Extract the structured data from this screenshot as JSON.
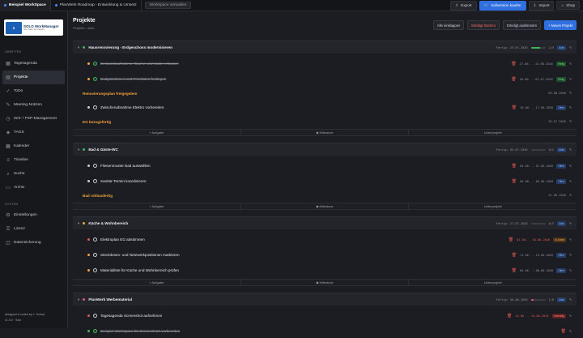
{
  "tabs": [
    {
      "label": "Beispiel WorkSpace",
      "dot": "#4f8cff"
    },
    {
      "label": "PlanWerk Roadmap - Entwicklung & Umsetz",
      "dot": "#4f8cff"
    },
    {
      "label": "Workspace verwalten",
      "dot": ""
    }
  ],
  "topbar": {
    "export": "Export",
    "full": "Vollversion kaufen",
    "import": "Import",
    "shop": "Shop"
  },
  "logo": {
    "name": "SOLO WorkManager",
    "sub": "plan, track, live happier"
  },
  "sidebar": {
    "section1": "ARBEITEN",
    "items": [
      {
        "label": "Tagesagenda",
        "icon": "calendar-icon"
      },
      {
        "label": "Projekte",
        "icon": "folder-icon"
      },
      {
        "label": "ToDo",
        "icon": "check-icon"
      },
      {
        "label": "Meeting-Notizen",
        "icon": "chat-icon"
      },
      {
        "label": "Zeit- / PSP-Management",
        "icon": "clock-icon"
      },
      {
        "label": "TAGS",
        "icon": "tag-icon"
      },
      {
        "label": "Kalender",
        "icon": "calendar-icon"
      },
      {
        "label": "Timeline",
        "icon": "timeline-icon"
      },
      {
        "label": "Suche",
        "icon": "search-icon"
      },
      {
        "label": "Archiv",
        "icon": "archive-icon"
      }
    ],
    "section2": "SYSTEM",
    "system": [
      {
        "label": "Einstellungen",
        "icon": "gear-icon"
      },
      {
        "label": "Lizenz",
        "icon": "key-icon"
      },
      {
        "label": "Datensicherung",
        "icon": "database-icon"
      }
    ],
    "footer1": "designed & coded by L. Scholz",
    "footer2": "v1.0.0 · Solo"
  },
  "header": {
    "title": "Projekte",
    "breadcrumb": "Projekte  ›  aktiv",
    "expand": "Alle einklappen",
    "delete_done": "Erledigt löschen",
    "hide_done": "Erledigt ausblenden",
    "new_project": "+ Neues Projekt"
  },
  "add_row": {
    "task": "+ Aufgabe",
    "milestone": "◆ Milestone",
    "sub": "Unterprojekt"
  },
  "rows": [
    {
      "kind": "group",
      "title": "Hausrenovierung - Erdgeschoss modernisieren",
      "meta": "Fertig: 25.07.2026",
      "count": "2/3",
      "badge": "Aktiv",
      "badgeClass": "b-offen",
      "progress": 0.66,
      "pcolor": "#3fb65c",
      "bullet": "#3fb65c"
    },
    {
      "kind": "task",
      "title": "Bestandsaufnahme Räume und Maße erfassen",
      "done": true,
      "date": "17.06. - 24.06.2026",
      "badge": "Fertig",
      "badgeClass": "b-fertig",
      "bullet": "#f0a23a"
    },
    {
      "kind": "task",
      "title": "Budgetrahmen und Prioritäten festlegen",
      "done": true,
      "date": "26.06. - 01.07.2026",
      "badge": "Fertig",
      "badgeClass": "b-fertig",
      "bullet": "#f0a23a"
    },
    {
      "kind": "milestone",
      "title": "Renovierungsplan freigegeben",
      "date": "03.08.2026"
    },
    {
      "kind": "task",
      "title": "Zwischenabnahme Elektro vorbereiten",
      "done": false,
      "date": "10.08. - 17.08.2026",
      "badge": "Offen",
      "badgeClass": "b-offen",
      "bullet": "#c9ccd2"
    },
    {
      "kind": "milestone",
      "title": "EG bezugsfertig",
      "date": "25.07.2026"
    },
    {
      "kind": "add"
    },
    {
      "kind": "group",
      "title": "Bad & Gäste-WC",
      "meta": "Fertig: 05.07.2026",
      "count": "0/2",
      "badge": "Aktiv",
      "badgeClass": "b-offen",
      "progress": 0,
      "pcolor": "#3fb65c",
      "bullet": "#3fb65c"
    },
    {
      "kind": "task",
      "title": "Fliesenmuster Bad auswählen",
      "done": false,
      "date": "03.06. - 07.06.2026",
      "badge": "Offen",
      "badgeClass": "b-offen",
      "bullet": "#c9ccd2"
    },
    {
      "kind": "task",
      "title": "Sanitär-Termin koordinieren",
      "done": false,
      "date": "05.06. - 09.06.2026",
      "badge": "Offen",
      "badgeClass": "b-offen",
      "bullet": "#c9ccd2"
    },
    {
      "kind": "milestone",
      "title": "Bad rohbaufertig",
      "date": "21.06.2026"
    },
    {
      "kind": "add"
    },
    {
      "kind": "group",
      "title": "Küche & Wohnbereich",
      "meta": "Fertig: 21.07.2026",
      "count": "0/3",
      "badge": "Aktiv",
      "badgeClass": "b-offen",
      "progress": 0,
      "pcolor": "#3fb65c",
      "bullet": "#f0a23a"
    },
    {
      "kind": "task",
      "title": "Elektroplan EG abstimmen",
      "done": false,
      "date": "01.06. - 04.06.2026",
      "badge": "In Arbeit",
      "badgeClass": "b-arbeit",
      "bullet": "#e0584f",
      "late": true
    },
    {
      "kind": "task",
      "title": "Steckdosen- und Netzwerkpositionen markieren",
      "done": false,
      "date": "11.06. - 15.06.2026",
      "badge": "Offen",
      "badgeClass": "b-offen",
      "bullet": "#f0a23a"
    },
    {
      "kind": "task",
      "title": "Materialliste für Küche und Wohnbereich prüfen",
      "done": false,
      "date": "05.06. - 08.06.2026",
      "badge": "Offen",
      "badgeClass": "b-offen",
      "bullet": "#f0a23a"
    },
    {
      "kind": "add"
    },
    {
      "kind": "group",
      "title": "PlanWerk Werbematerial",
      "meta": "Fertig: 30.06.2026",
      "count": "1/6",
      "badge": "Aktiv",
      "badgeClass": "b-offen",
      "progress": 0.2,
      "pcolor": "#e0509a",
      "bullet": "#e0509a"
    },
    {
      "kind": "task",
      "title": "Tagesagenda Screenshot aufnehmen",
      "done": false,
      "date": "15.06. - 15.06.2026",
      "badge": "Überfällig",
      "badgeClass": "b-uber",
      "bullet": "#e0584f",
      "late": true
    },
    {
      "kind": "task",
      "title": "Beispiel-Workspace für Screenshots vorbereiten",
      "done": true,
      "date": "",
      "badge": "",
      "badgeClass": "",
      "bullet": "#3fb65c"
    }
  ]
}
